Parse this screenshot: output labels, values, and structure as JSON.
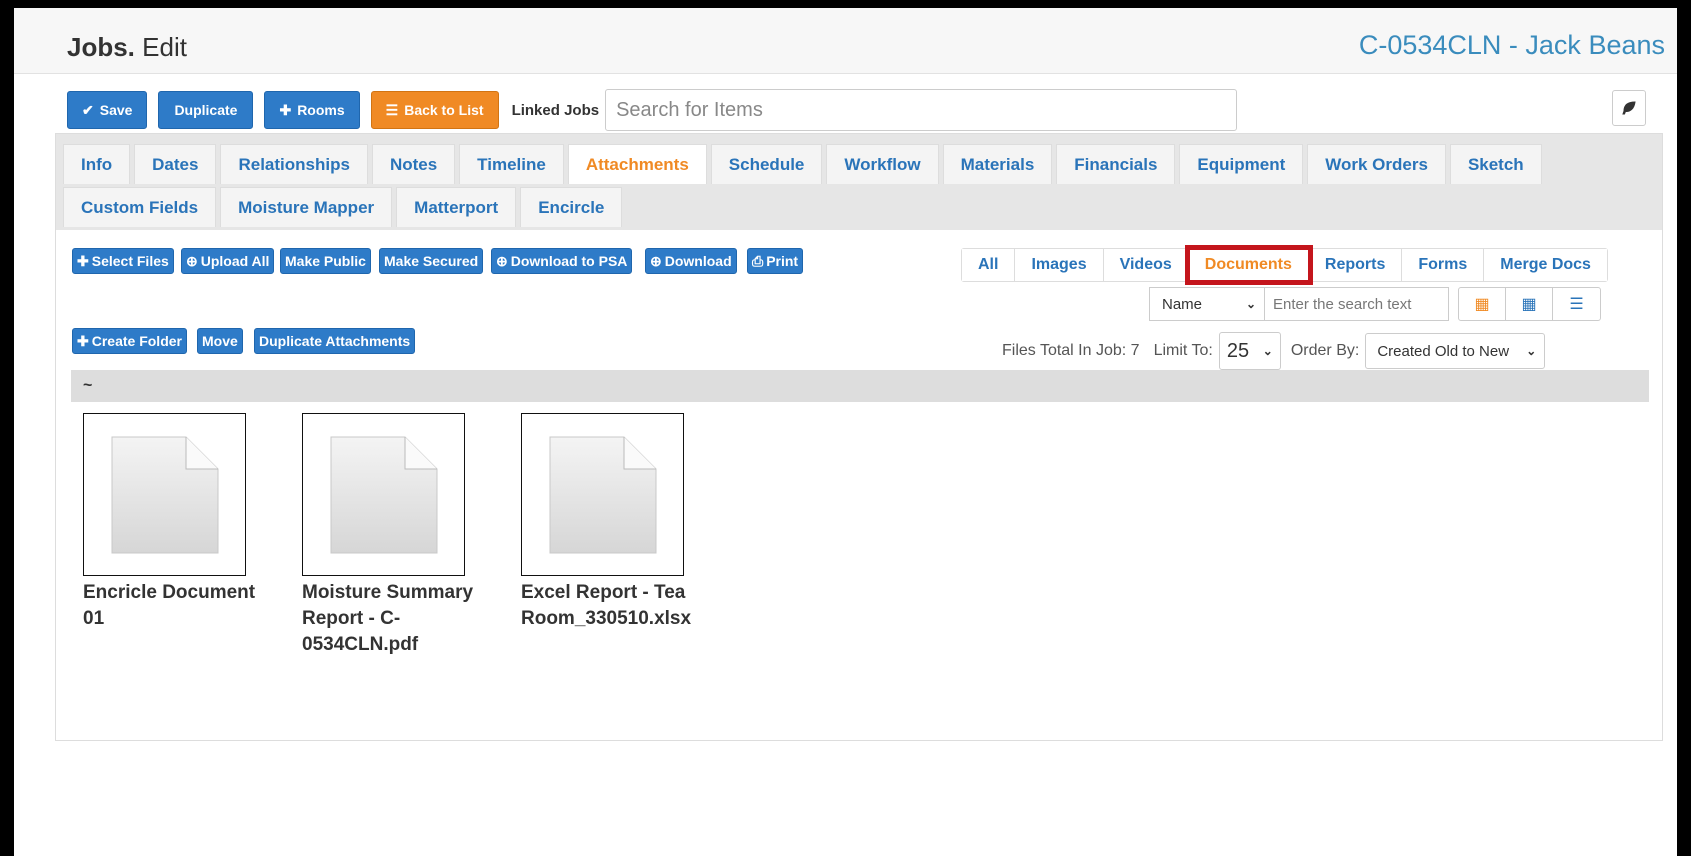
{
  "header": {
    "title_bold": "Jobs.",
    "title_rest": " Edit",
    "job_title": "C-0534CLN - Jack Beans"
  },
  "toolbar": {
    "save_label": "Save",
    "duplicate_label": "Duplicate",
    "rooms_label": "Rooms",
    "back_label": "Back to List",
    "linked_jobs_label": "Linked Jobs",
    "linked_jobs_placeholder": "Search for Items"
  },
  "tabs": {
    "row1": [
      "Info",
      "Dates",
      "Relationships",
      "Notes",
      "Timeline",
      "Attachments",
      "Schedule",
      "Workflow",
      "Materials",
      "Financials",
      "Equipment",
      "Work Orders",
      "Sketch"
    ],
    "row2": [
      "Custom Fields",
      "Moisture Mapper",
      "Matterport",
      "Encircle"
    ],
    "active": "Attachments"
  },
  "file_actions": {
    "select_files": "Select Files",
    "upload_all": "Upload All",
    "make_public": "Make Public",
    "make_secured": "Make Secured",
    "download_psa": "Download to PSA",
    "download": "Download",
    "print": "Print",
    "create_folder": "Create Folder",
    "move": "Move",
    "duplicate_attachments": "Duplicate Attachments"
  },
  "filter_tabs": {
    "items": [
      "All",
      "Images",
      "Videos",
      "Documents",
      "Reports",
      "Forms",
      "Merge Docs"
    ],
    "active": "Documents"
  },
  "search": {
    "field_value": "Name",
    "placeholder": "Enter the search text"
  },
  "listing": {
    "files_total_label": "Files Total In Job: 7",
    "limit_label": "Limit To:",
    "limit_value": "25",
    "order_label": "Order By:",
    "order_value": "Created Old to New",
    "folder": "~"
  },
  "files": [
    {
      "name": "Encricle Document 01"
    },
    {
      "name": "Moisture Summary Report - C-0534CLN.pdf"
    },
    {
      "name": "Excel Report - Tea Room_330510.xlsx"
    }
  ],
  "colors": {
    "accent_blue": "#2e7bc8",
    "accent_orange": "#f08a24",
    "highlight_red": "#c4151c",
    "title_blue": "#3a8cbd"
  }
}
